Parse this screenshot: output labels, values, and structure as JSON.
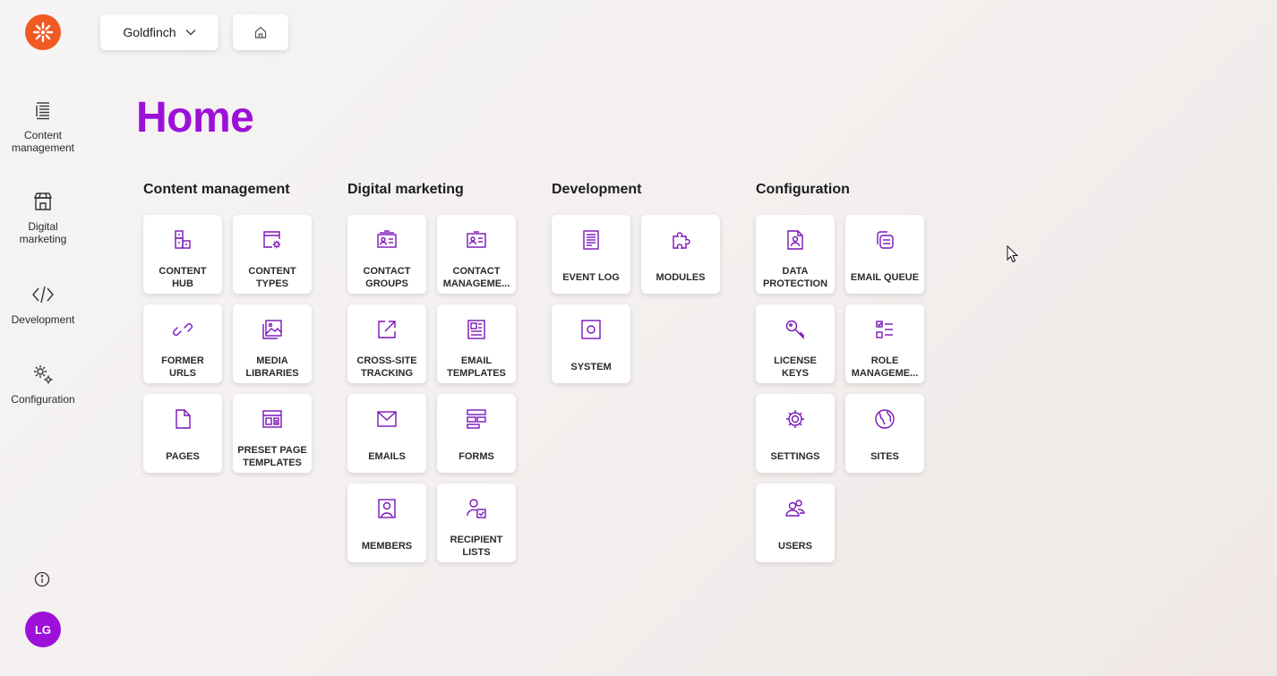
{
  "sidebar": {
    "items": [
      {
        "label": "Content management",
        "icon": "content-management-icon"
      },
      {
        "label": "Digital marketing",
        "icon": "storefront-icon"
      },
      {
        "label": "Development",
        "icon": "code-icon"
      },
      {
        "label": "Configuration",
        "icon": "gears-icon"
      }
    ],
    "avatar_initials": "LG"
  },
  "topbar": {
    "site_selector": "Goldfinch"
  },
  "page": {
    "title": "Home"
  },
  "sections": [
    {
      "title": "Content management",
      "tiles": [
        {
          "l1": "CONTENT",
          "l2": "HUB",
          "icon": "content-hub-icon"
        },
        {
          "l1": "CONTENT",
          "l2": "TYPES",
          "icon": "content-types-icon"
        },
        {
          "l1": "FORMER",
          "l2": "URLS",
          "icon": "link-icon"
        },
        {
          "l1": "MEDIA",
          "l2": "LIBRARIES",
          "icon": "media-library-icon"
        },
        {
          "l1": "PAGES",
          "l2": "",
          "icon": "page-icon"
        },
        {
          "l1": "PRESET PAGE",
          "l2": "TEMPLATES",
          "icon": "page-template-icon"
        }
      ]
    },
    {
      "title": "Digital marketing",
      "tiles": [
        {
          "l1": "CONTACT",
          "l2": "GROUPS",
          "icon": "contact-groups-icon"
        },
        {
          "l1": "CONTACT",
          "l2": "MANAGEME...",
          "icon": "contact-card-icon"
        },
        {
          "l1": "CROSS-SITE",
          "l2": "TRACKING",
          "icon": "external-link-icon"
        },
        {
          "l1": "EMAIL",
          "l2": "TEMPLATES",
          "icon": "newsletter-icon"
        },
        {
          "l1": "EMAILS",
          "l2": "",
          "icon": "envelope-icon"
        },
        {
          "l1": "FORMS",
          "l2": "",
          "icon": "form-icon"
        },
        {
          "l1": "MEMBERS",
          "l2": "",
          "icon": "member-icon"
        },
        {
          "l1": "RECIPIENT",
          "l2": "LISTS",
          "icon": "recipient-list-icon"
        }
      ]
    },
    {
      "title": "Development",
      "tiles": [
        {
          "l1": "EVENT LOG",
          "l2": "",
          "icon": "log-icon"
        },
        {
          "l1": "MODULES",
          "l2": "",
          "icon": "puzzle-icon"
        },
        {
          "l1": "SYSTEM",
          "l2": "",
          "icon": "system-icon"
        }
      ]
    },
    {
      "title": "Configuration",
      "tiles": [
        {
          "l1": "DATA",
          "l2": "PROTECTION",
          "icon": "data-protection-icon"
        },
        {
          "l1": "EMAIL QUEUE",
          "l2": "",
          "icon": "email-queue-icon"
        },
        {
          "l1": "LICENSE",
          "l2": "KEYS",
          "icon": "key-icon"
        },
        {
          "l1": "ROLE",
          "l2": "MANAGEME...",
          "icon": "role-checklist-icon"
        },
        {
          "l1": "SETTINGS",
          "l2": "",
          "icon": "gear-icon"
        },
        {
          "l1": "SITES",
          "l2": "",
          "icon": "globe-icon"
        },
        {
          "l1": "USERS",
          "l2": "",
          "icon": "users-icon"
        }
      ]
    }
  ],
  "colors": {
    "accent": "#9d10d8",
    "logo": "#f05a22",
    "icon": "#7a14b8"
  }
}
